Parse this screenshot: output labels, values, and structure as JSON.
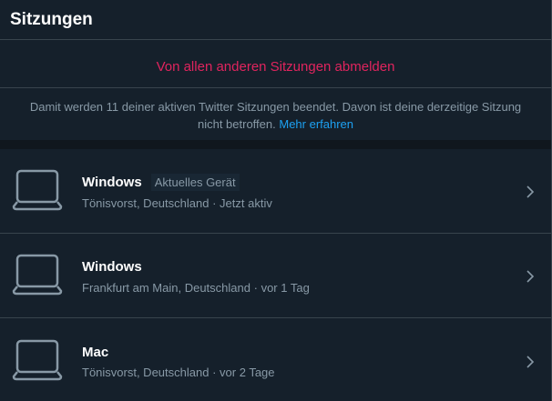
{
  "header": {
    "title": "Sitzungen"
  },
  "logout": {
    "label": "Von allen anderen Sitzungen abmelden"
  },
  "info": {
    "text": "Damit werden 11 deiner aktiven Twitter Sitzungen beendet. Davon ist deine derzeitige Sitzung nicht betroffen.",
    "link": "Mehr erfahren"
  },
  "sessions": [
    {
      "device": "Windows",
      "badge": "Aktuelles Gerät",
      "location": "Tönisvorst, Deutschland",
      "sep": "·",
      "time": "Jetzt aktiv",
      "icon": "laptop-icon"
    },
    {
      "device": "Windows",
      "badge": "",
      "location": "Frankfurt am Main, Deutschland",
      "sep": "·",
      "time": "vor 1 Tag",
      "icon": "laptop-icon"
    },
    {
      "device": "Mac",
      "badge": "",
      "location": "Tönisvorst, Deutschland",
      "sep": "·",
      "time": "vor 2 Tage",
      "icon": "laptop-icon"
    }
  ],
  "colors": {
    "background": "#15202b",
    "danger": "#e0245e",
    "link": "#1da1f2",
    "muted": "#8899a6",
    "border": "#38444d"
  }
}
